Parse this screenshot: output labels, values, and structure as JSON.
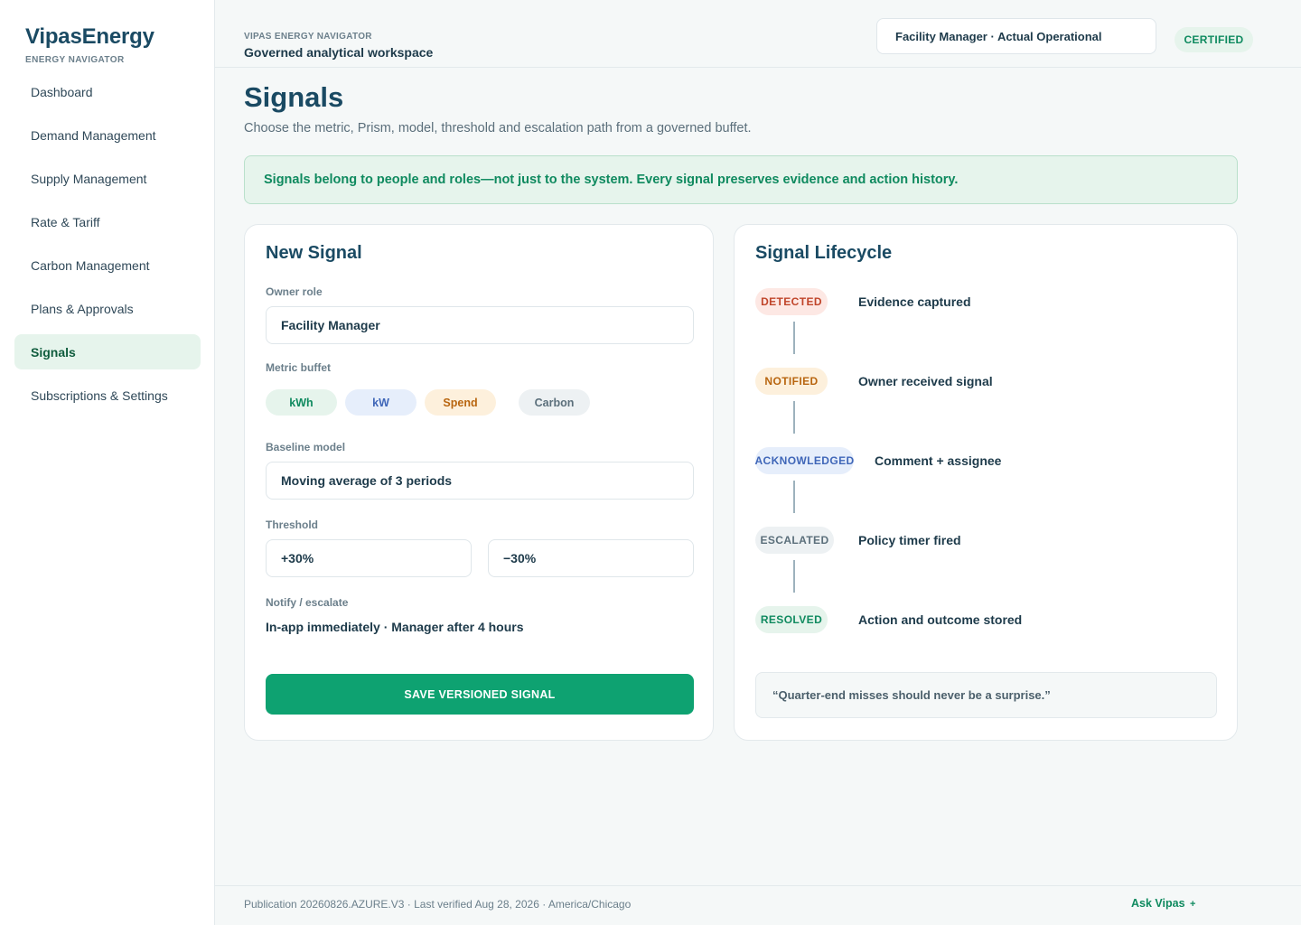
{
  "brand": {
    "name": "VipasEnergy",
    "subtitle": "ENERGY NAVIGATOR"
  },
  "sidebar": {
    "items": [
      {
        "label": "Dashboard"
      },
      {
        "label": "Demand Management"
      },
      {
        "label": "Supply Management"
      },
      {
        "label": "Rate & Tariff"
      },
      {
        "label": "Carbon Management"
      },
      {
        "label": "Plans & Approvals"
      },
      {
        "label": "Signals",
        "active": true
      },
      {
        "label": "Subscriptions & Settings"
      }
    ]
  },
  "header": {
    "eyebrow": "VIPAS ENERGY NAVIGATOR",
    "title": "Governed analytical workspace",
    "role_selector": "Facility Manager · Actual Operational",
    "badge": "CERTIFIED"
  },
  "page": {
    "title": "Signals",
    "subtitle": "Choose the metric, Prism, model, threshold and escalation path from a governed buffet.",
    "banner": "Signals belong to people and roles—not just to the system. Every signal preserves evidence and action history."
  },
  "new_signal": {
    "title": "New Signal",
    "owner_role_label": "Owner role",
    "owner_role_value": "Facility Manager",
    "metric_label": "Metric buffet",
    "metrics": [
      "kWh",
      "kW",
      "Spend",
      "Carbon"
    ],
    "baseline_label": "Baseline model",
    "baseline_value": "Moving average of 3 periods",
    "threshold_label": "Threshold",
    "threshold_upper": "+30%",
    "threshold_lower": "−30%",
    "notify_label": "Notify / escalate",
    "notify_value": "In-app immediately · Manager after 4 hours",
    "save_label": "SAVE VERSIONED SIGNAL"
  },
  "lifecycle": {
    "title": "Signal Lifecycle",
    "steps": [
      {
        "state": "DETECTED",
        "text": "Evidence captured"
      },
      {
        "state": "NOTIFIED",
        "text": "Owner received signal"
      },
      {
        "state": "ACKNOWLEDGED",
        "text": "Comment + assignee"
      },
      {
        "state": "ESCALATED",
        "text": "Policy timer fired"
      },
      {
        "state": "RESOLVED",
        "text": "Action and outcome stored"
      }
    ],
    "quote": "“Quarter-end misses should never be a surprise.”"
  },
  "footer": {
    "publication": "Publication 20260826.AZURE.V3 · Last verified Aug 28, 2026 · America/Chicago",
    "ask_label": "Ask Vipas",
    "ask_icon": "+"
  },
  "colors": {
    "accent": "#0ea271",
    "brand": "#1a4a63",
    "detected_bg": "#fde8e4",
    "detected_fg": "#c0452a",
    "notified_bg": "#fdf0dc",
    "notified_fg": "#b8650f",
    "acknowledged_bg": "#e6eefb",
    "acknowledged_fg": "#3f66b8",
    "escalated_bg": "#edf1f3",
    "escalated_fg": "#5b6f7b",
    "resolved_bg": "#e6f4ec",
    "resolved_fg": "#0f8a5f"
  }
}
